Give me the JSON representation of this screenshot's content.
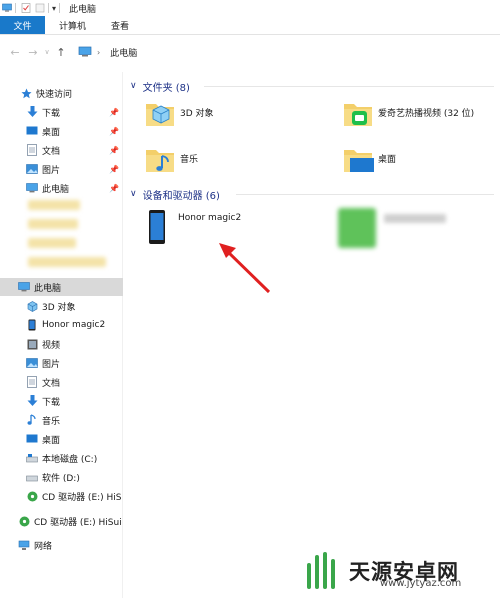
{
  "window": {
    "title": "此电脑"
  },
  "ribbon": {
    "tabs": [
      "文件",
      "计算机",
      "查看"
    ]
  },
  "address": {
    "path": "此电脑"
  },
  "nav": {
    "quick_access": "快速访问",
    "pinned": [
      "下载",
      "桌面",
      "文档",
      "图片",
      "此电脑"
    ],
    "this_pc": "此电脑",
    "this_pc_items": [
      "3D 对象",
      "Honor magic2",
      "视频",
      "图片",
      "文档",
      "下载",
      "音乐",
      "桌面",
      "本地磁盘 (C:)",
      "软件 (D:)",
      "CD 驱动器 (E:) HiS"
    ],
    "cd_drive": "CD 驱动器 (E:) HiSui",
    "network": "网络"
  },
  "folders": {
    "header": "文件夹 (8)",
    "items": [
      "3D 对象",
      "爱奇艺热播视频 (32 位)",
      "音乐",
      "桌面"
    ]
  },
  "devices": {
    "header": "设备和驱动器 (6)",
    "items": [
      "Honor magic2"
    ]
  },
  "watermark": {
    "text": "天源安卓网",
    "url": "www.jytyaz.com"
  },
  "colors": {
    "accent": "#1979ca",
    "group_header": "#1e3287",
    "arrow": "#e02020",
    "selected": "#d9d9d9"
  }
}
